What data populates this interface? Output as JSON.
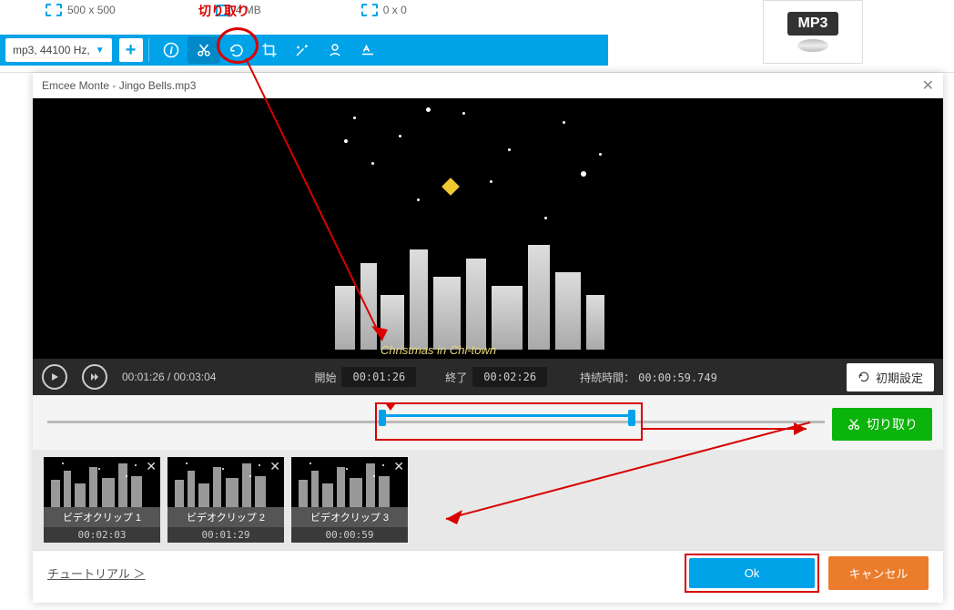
{
  "top": {
    "dimensions": "500 x 500",
    "filesize": "4 MB",
    "out_dim": "0 x 0",
    "annotation_cut": "切り取り",
    "format": "mp3, 44100 Hz,"
  },
  "mp3_badge": "MP3",
  "modal": {
    "title": "Emcee Monte - Jingo Bells.mp3",
    "caption": "Christmas in Chi-town",
    "player": {
      "current": "00:01:26",
      "total": "00:03:04",
      "start_label": "開始",
      "start_val": "00:01:26",
      "end_label": "終了",
      "end_val": "00:02:26",
      "duration_label": "持続時間：",
      "duration_val": "00:00:59.749",
      "reset": "初期設定"
    },
    "cut_button": "切り取り",
    "clips": [
      {
        "name": "ビデオクリップ 1",
        "dur": "00:02:03"
      },
      {
        "name": "ビデオクリップ 2",
        "dur": "00:01:29"
      },
      {
        "name": "ビデオクリップ 3",
        "dur": "00:00:59"
      }
    ],
    "tutorial": "チュートリアル ＞",
    "ok": "Ok",
    "cancel": "キャンセル"
  }
}
